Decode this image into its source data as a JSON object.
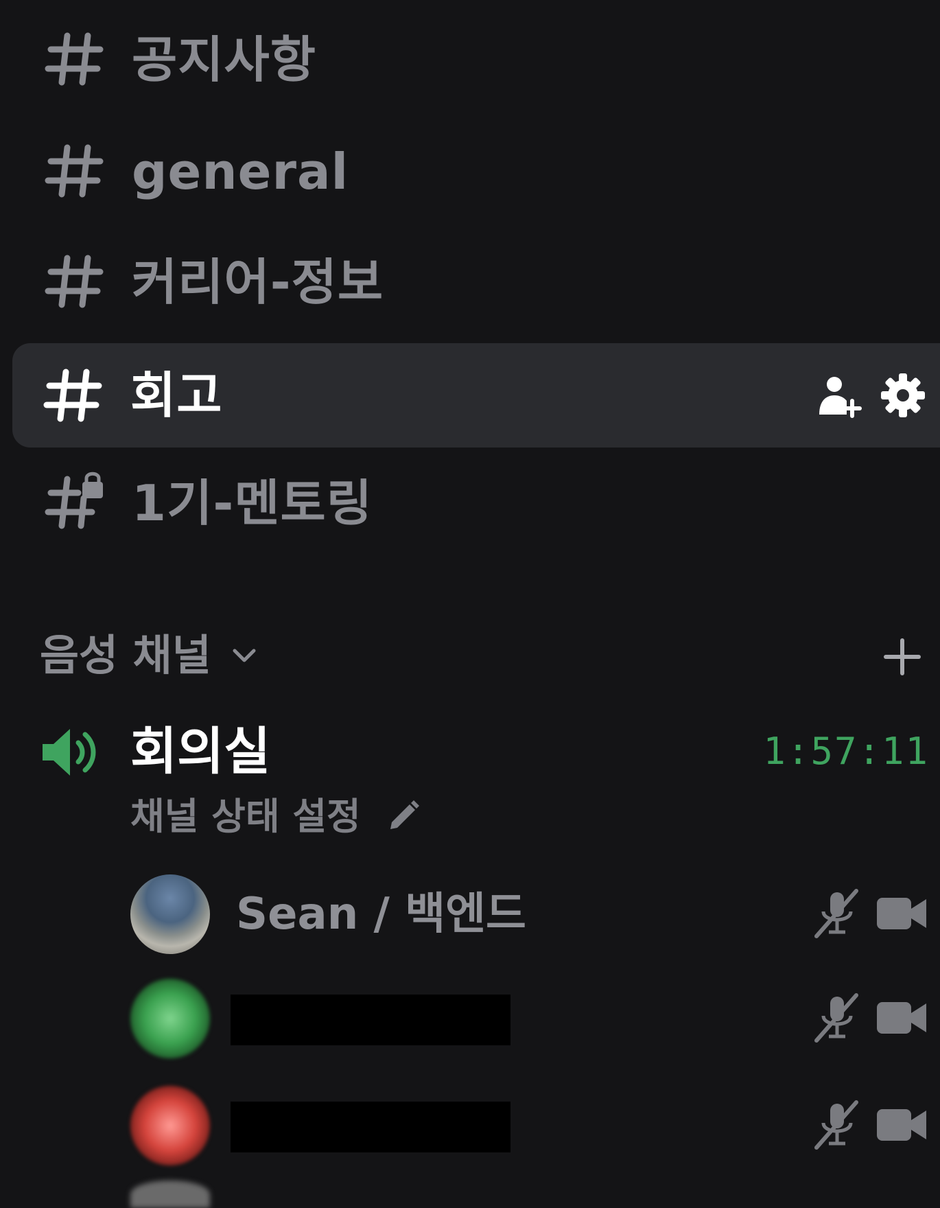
{
  "text_channels": [
    {
      "name": "공지사항",
      "active": false,
      "locked": false
    },
    {
      "name": "general",
      "active": false,
      "locked": false
    },
    {
      "name": "커리어-정보",
      "active": false,
      "locked": false
    },
    {
      "name": "회고",
      "active": true,
      "locked": false
    },
    {
      "name": "1기-멘토링",
      "active": false,
      "locked": true
    }
  ],
  "voice_category": {
    "label": "음성 채널",
    "chevron_icon": "chevron-down-icon",
    "add_icon": "plus-icon"
  },
  "voice_channel": {
    "name": "회의실",
    "elapsed": "1:57:11",
    "status_prompt": "채널 상태 설정",
    "icon": "speaker-icon"
  },
  "voice_members": [
    {
      "name": "Sean / 백엔드",
      "avatar": "photo",
      "muted": true,
      "camera": true
    },
    {
      "name": "",
      "avatar": "green",
      "redacted": true,
      "muted": true,
      "camera": true
    },
    {
      "name": "",
      "avatar": "red",
      "redacted": true,
      "muted": true,
      "camera": true
    }
  ],
  "colors": {
    "background": "#141416",
    "active_row": "#2a2b2f",
    "text_muted": "#8a8b91",
    "text_active": "#ffffff",
    "voice_green": "#3fa45f"
  }
}
